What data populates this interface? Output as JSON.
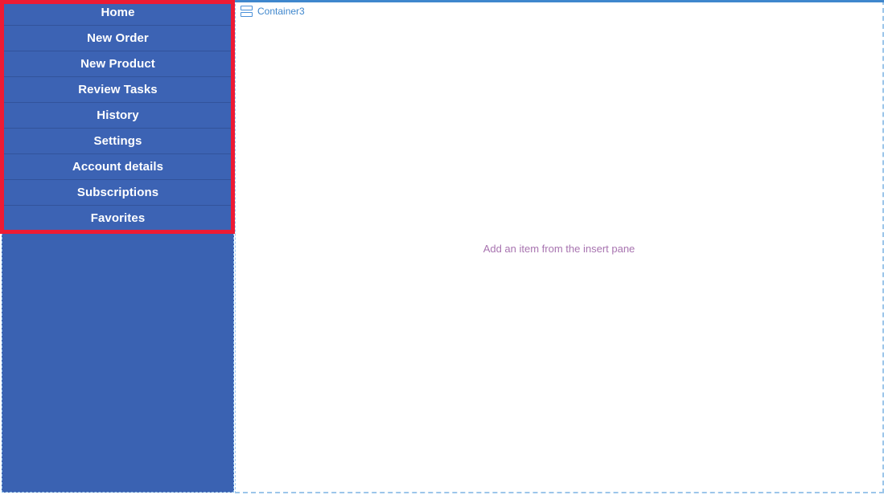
{
  "colors": {
    "sidebar_background": "#3a62b2",
    "nav_item_background": "#3c63b4",
    "nav_item_separator": "#32539b",
    "nav_item_text": "#ffffff",
    "selection_outline": "#ed1b34",
    "panel_border": "#9cc6ea",
    "panel_top_rule": "#3f87cd",
    "container_label_text": "#3f87cd",
    "empty_hint_text": "#a874b0",
    "canvas_background": "#ffffff"
  },
  "sidebar": {
    "name": "navigation-gallery",
    "selected": true,
    "items": [
      {
        "label": "Home"
      },
      {
        "label": "New Order"
      },
      {
        "label": "New Product"
      },
      {
        "label": "Review Tasks"
      },
      {
        "label": "History"
      },
      {
        "label": "Settings"
      },
      {
        "label": "Account details"
      },
      {
        "label": "Subscriptions"
      },
      {
        "label": "Favorites"
      }
    ]
  },
  "content": {
    "container": {
      "icon": "stacked-container-icon",
      "label": "Container3"
    },
    "empty_state": {
      "message": "Add an item from the insert pane"
    }
  }
}
